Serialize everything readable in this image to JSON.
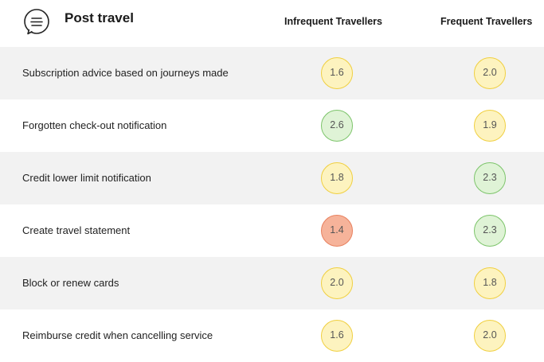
{
  "header": {
    "icon": "speech-bubble-icon",
    "title": "Post travel",
    "columns": [
      "Infrequent Travellers",
      "Frequent Travellers"
    ]
  },
  "colors": {
    "yellow_fill": "#fdf3bf",
    "yellow_border": "#f0cf3f",
    "green_fill": "#dff3d6",
    "green_border": "#7cc46a",
    "red_fill": "#f6b39a",
    "red_border": "#e8805e",
    "row_shade": "#f2f2f2"
  },
  "rows": [
    {
      "label": "Subscription advice based on journeys made",
      "infrequent": {
        "value": "1.6",
        "level": "yellow"
      },
      "frequent": {
        "value": "2.0",
        "level": "yellow"
      }
    },
    {
      "label": "Forgotten check-out notification",
      "infrequent": {
        "value": "2.6",
        "level": "green"
      },
      "frequent": {
        "value": "1.9",
        "level": "yellow"
      }
    },
    {
      "label": "Credit lower limit notification",
      "infrequent": {
        "value": "1.8",
        "level": "yellow"
      },
      "frequent": {
        "value": "2.3",
        "level": "green"
      }
    },
    {
      "label": "Create travel statement",
      "infrequent": {
        "value": "1.4",
        "level": "red"
      },
      "frequent": {
        "value": "2.3",
        "level": "green"
      }
    },
    {
      "label": "Block or renew cards",
      "infrequent": {
        "value": "2.0",
        "level": "yellow"
      },
      "frequent": {
        "value": "1.8",
        "level": "yellow"
      }
    },
    {
      "label": "Reimburse credit when cancelling service",
      "infrequent": {
        "value": "1.6",
        "level": "yellow"
      },
      "frequent": {
        "value": "2.0",
        "level": "yellow"
      }
    }
  ]
}
